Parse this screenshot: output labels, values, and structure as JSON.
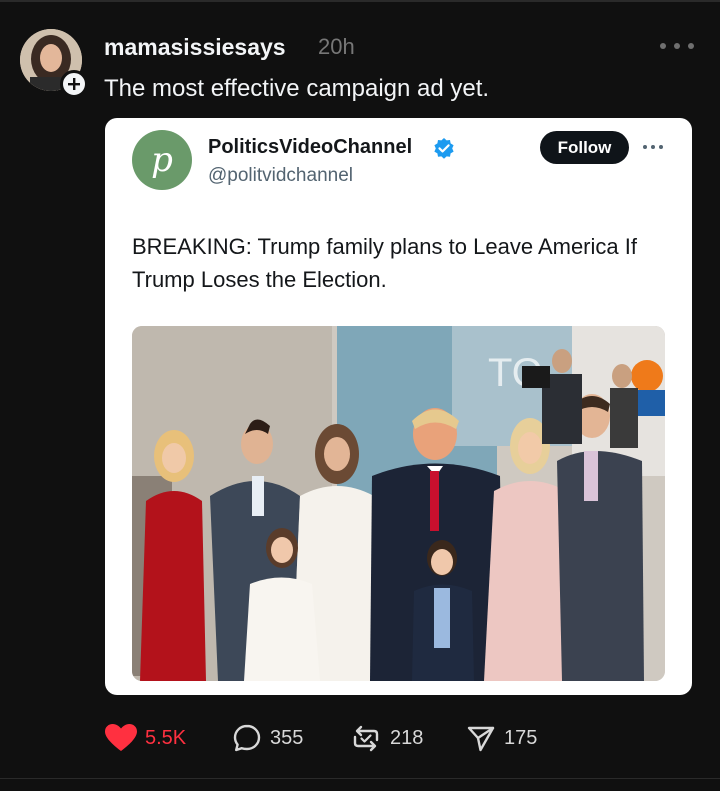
{
  "post": {
    "username": "mamasissiesays",
    "time": "20h",
    "text": "The most effective campaign ad yet."
  },
  "embedded_tweet": {
    "avatar_letter": "p",
    "name": "PoliticsVideoChannel",
    "handle": "@politvidchannel",
    "follow_label": "Follow",
    "text": "BREAKING: Trump family plans to Leave America If Trump Loses the Election.",
    "photo_sign_text": "TO"
  },
  "actions": {
    "likes": "5.5K",
    "replies": "355",
    "reposts": "218",
    "shares": "175"
  },
  "colors": {
    "background": "#101010",
    "like_red": "#ff3040",
    "verified_blue": "#1d9bf0",
    "card_bg": "#ffffff"
  },
  "icons": [
    "plus-icon",
    "more-icon",
    "verified-badge-icon",
    "heart-icon",
    "reply-icon",
    "repost-icon",
    "share-icon"
  ]
}
